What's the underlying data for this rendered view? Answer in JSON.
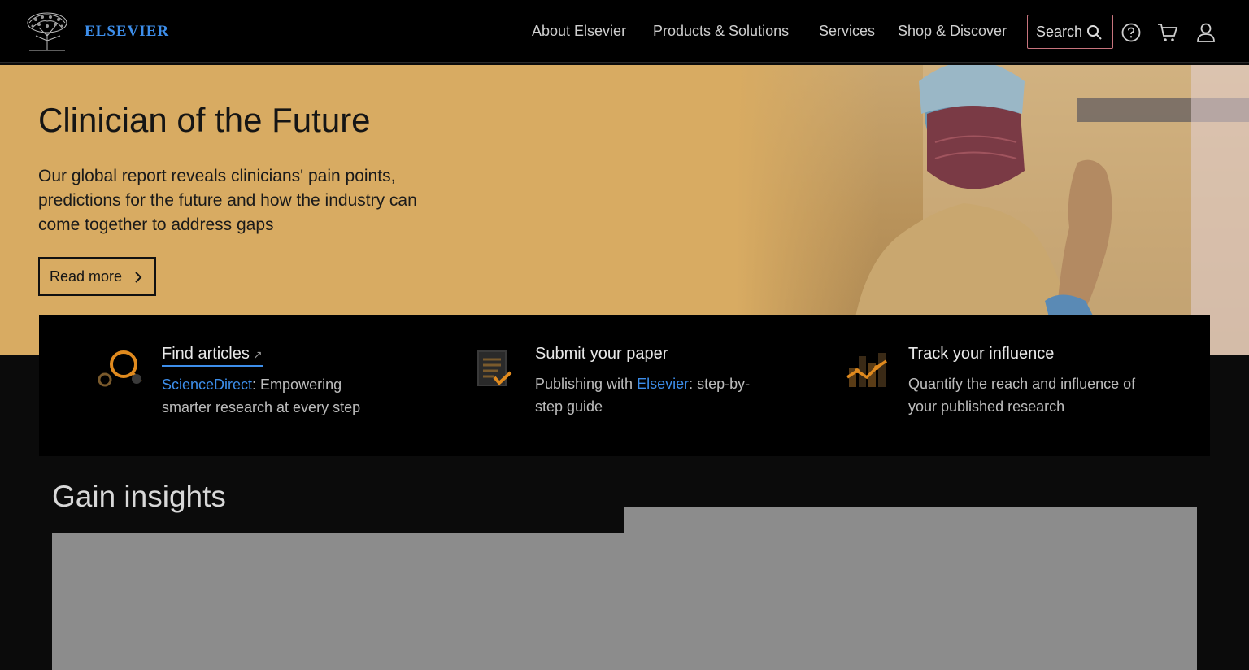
{
  "header": {
    "brand": "ELSEVIER",
    "nav": [
      "About Elsevier",
      "Products & Solutions",
      "Services",
      "Shop & Discover"
    ],
    "search_label": "Search",
    "icons": [
      "search-icon",
      "help-icon",
      "cart-icon",
      "user-icon"
    ]
  },
  "hero": {
    "title": "Clinician of the Future",
    "text": "Our global report reveals clinicians' pain points, predictions for the future and how the industry can come together to address gaps",
    "button_label": "Read more"
  },
  "quick_actions": [
    {
      "title": "Find articles",
      "link_text": "ScienceDirect",
      "desc_rest": ": Empowering smarter research at every step",
      "icon": "magnifier-icon"
    },
    {
      "title": "Submit your paper",
      "desc_before": "Publishing with ",
      "link_text": "Elsevier",
      "desc_rest": ": step-by-step guide",
      "icon": "document-check-icon"
    },
    {
      "title": "Track your influence",
      "desc": "Quantify the reach and influence of your published research",
      "icon": "chart-trend-icon"
    }
  ],
  "insights": {
    "title": "Gain insights"
  },
  "colors": {
    "accent": "#3d8eea",
    "hero_bg": "#d8ab62",
    "icon_orange": "#e08a1e"
  }
}
